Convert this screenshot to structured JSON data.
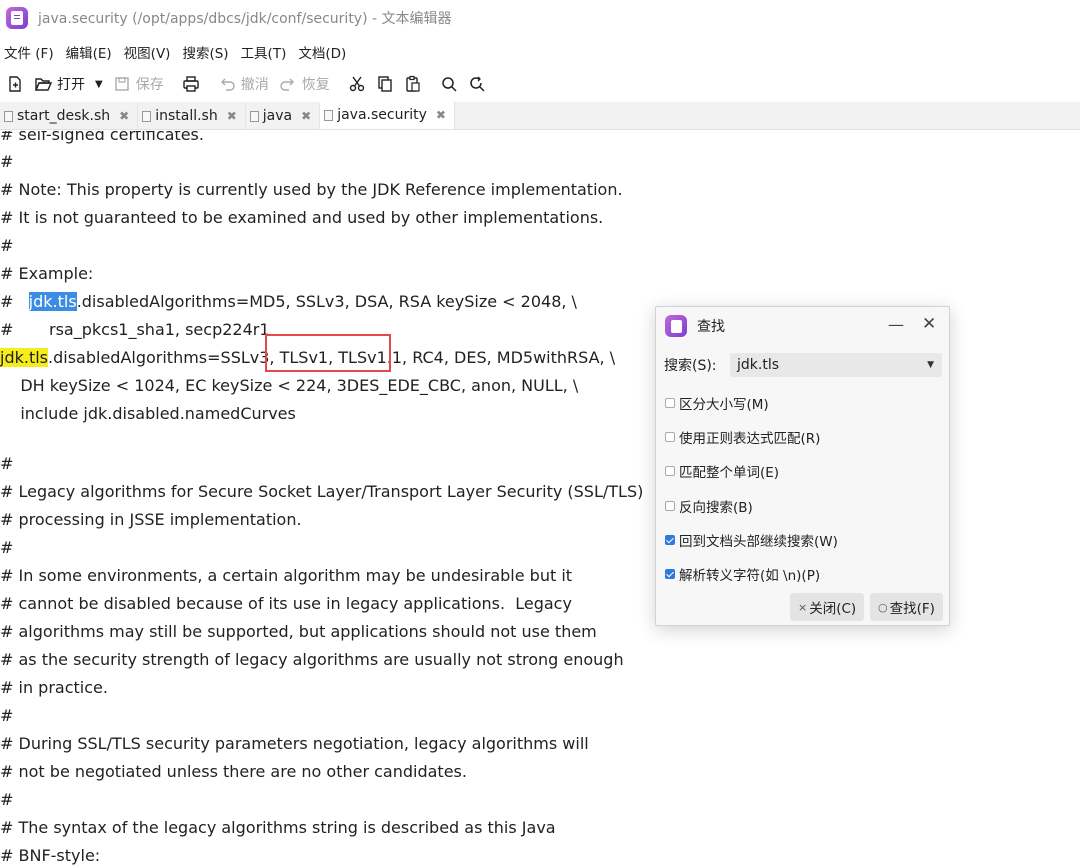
{
  "window": {
    "title": "java.security (/opt/apps/dbcs/jdk/conf/security) - 文本编辑器"
  },
  "menu": [
    "文件 (F)",
    "编辑(E)",
    "视图(V)",
    "搜索(S)",
    "工具(T)",
    "文档(D)"
  ],
  "toolbar": {
    "open_label": "打开",
    "save_label": "保存",
    "undo_label": "撤消",
    "redo_label": "恢复"
  },
  "tabs": [
    {
      "label": "start_desk.sh",
      "active": false
    },
    {
      "label": "install.sh",
      "active": false
    },
    {
      "label": "java",
      "active": false
    },
    {
      "label": "java.security",
      "active": true
    }
  ],
  "editor": {
    "lines": [
      "# self-signed certificates.",
      "#",
      "# Note: This property is currently used by the JDK Reference implementation.",
      "# It is not guaranteed to be examined and used by other implementations.",
      "#",
      "# Example:",
      {
        "prefix": "#   ",
        "match": "jdk.tls",
        "rest": ".disabledAlgorithms=MD5, SSLv3, DSA, RSA keySize < 2048, \\"
      },
      "#       rsa_pkcs1_sha1, secp224r1",
      {
        "match": "jdk.tls",
        "rest": ".disabledAlgorithms=SSLv3, TLSv1, TLSv1.1, RC4, DES, MD5withRSA, \\"
      },
      "    DH keySize < 1024, EC keySize < 224, 3DES_EDE_CBC, anon, NULL, \\",
      "    include jdk.disabled.namedCurves",
      "",
      "#",
      "# Legacy algorithms for Secure Socket Layer/Transport Layer Security (SSL/TLS)",
      "# processing in JSSE implementation.",
      "#",
      "# In some environments, a certain algorithm may be undesirable but it",
      "# cannot be disabled because of its use in legacy applications.  Legacy",
      "# algorithms may still be supported, but applications should not use them",
      "# as the security strength of legacy algorithms are usually not strong enough",
      "# in practice.",
      "#",
      "# During SSL/TLS security parameters negotiation, legacy algorithms will",
      "# not be negotiated unless there are no other candidates.",
      "#",
      "# The syntax of the legacy algorithms string is described as this Java",
      "# BNF-style:"
    ]
  },
  "find_dialog": {
    "title": "查找",
    "search_label": "搜索(S):",
    "search_value": "jdk.tls",
    "options": [
      {
        "label": "区分大小写(M)",
        "checked": false
      },
      {
        "label": "使用正则表达式匹配(R)",
        "checked": false
      },
      {
        "label": "匹配整个单词(E)",
        "checked": false
      },
      {
        "label": "反向搜索(B)",
        "checked": false
      },
      {
        "label": "回到文档头部继续搜索(W)",
        "checked": true
      },
      {
        "label": "解析转义字符(如 \\n)(P)",
        "checked": true
      }
    ],
    "close_label": "关闭(C)",
    "find_label": "查找(F)"
  },
  "colors": {
    "highlight_current": "#3b8de3",
    "highlight_match": "#f6ec1c",
    "annotation_box": "#e5484d",
    "checkbox_on": "#2f7bdc"
  }
}
